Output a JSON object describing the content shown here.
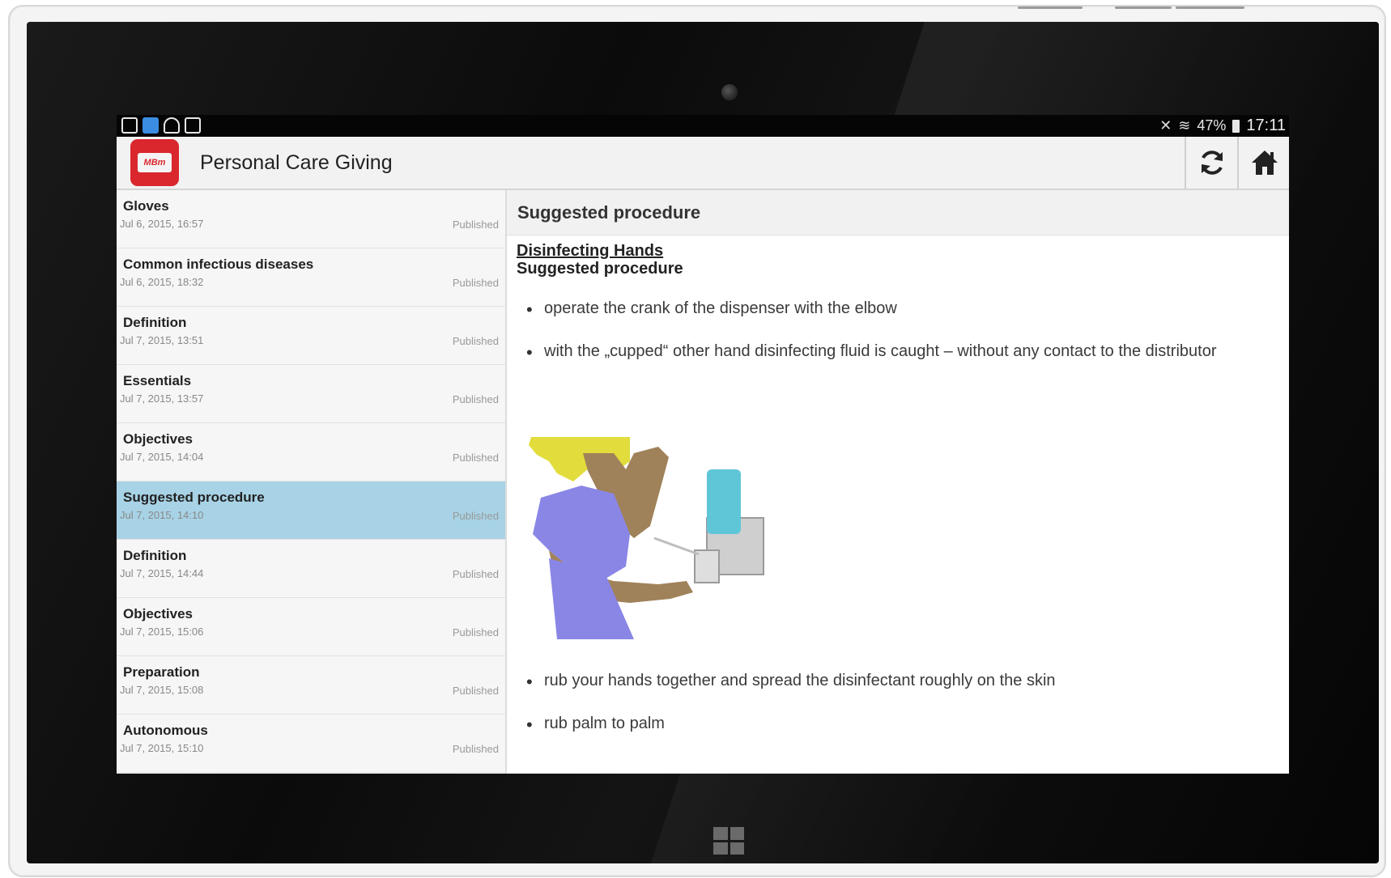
{
  "status_bar": {
    "left_icons": [
      "screenshot-icon",
      "checkbox-icon",
      "android-icon",
      "clipboard-icon"
    ],
    "battery": "47%",
    "time": "17:11"
  },
  "app": {
    "title": "Personal Care Giving",
    "logo_text": "MBm"
  },
  "list": {
    "items": [
      {
        "title": "Gloves",
        "date": "Jul 6, 2015, 16:57",
        "status": "Published"
      },
      {
        "title": "Common infectious diseases",
        "date": "Jul 6, 2015, 18:32",
        "status": "Published"
      },
      {
        "title": "Definition",
        "date": "Jul 7, 2015, 13:51",
        "status": "Published"
      },
      {
        "title": "Essentials",
        "date": "Jul 7, 2015, 13:57",
        "status": "Published"
      },
      {
        "title": "Objectives",
        "date": "Jul 7, 2015, 14:04",
        "status": "Published"
      },
      {
        "title": "Suggested procedure",
        "date": "Jul 7, 2015, 14:10",
        "status": "Published",
        "selected": true
      },
      {
        "title": "Definition",
        "date": "Jul 7, 2015, 14:44",
        "status": "Published"
      },
      {
        "title": "Objectives",
        "date": "Jul 7, 2015, 15:06",
        "status": "Published"
      },
      {
        "title": "Preparation",
        "date": "Jul 7, 2015, 15:08",
        "status": "Published"
      },
      {
        "title": "Autonomous",
        "date": "Jul 7, 2015, 15:10",
        "status": "Published"
      }
    ]
  },
  "detail": {
    "header": "Suggested procedure",
    "doc_title": "Disinfecting Hands",
    "doc_subtitle": "Suggested procedure",
    "bullets_top": [
      "operate the crank of the dispenser with the elbow",
      "with the „cupped“ other hand disinfecting fluid is caught – without any contact to the distributor"
    ],
    "bullets_bottom": [
      "rub your hands together and spread the disinfectant roughly on the skin",
      "rub palm to palm"
    ]
  },
  "colors": {
    "app_logo": "#d9272d",
    "selected_row": "#a8d3e6",
    "shirt": "#8a86e6",
    "dispenser_fluid": "#5fc6d8"
  }
}
